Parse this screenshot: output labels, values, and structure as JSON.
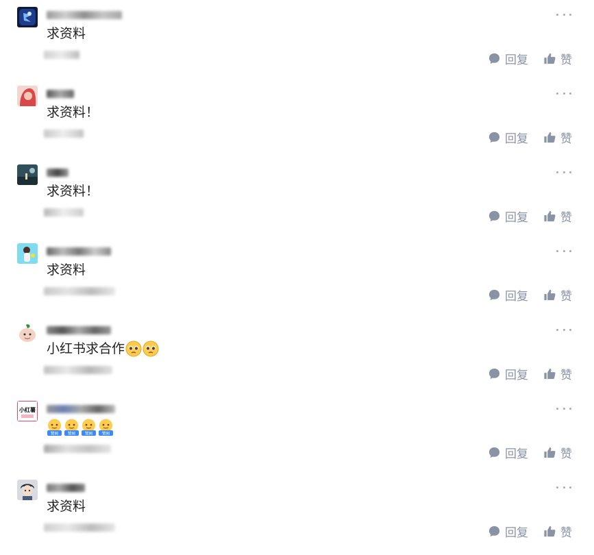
{
  "actions": {
    "reply_label": "回复",
    "like_label": "赞"
  },
  "comments": [
    {
      "text": "求资料",
      "kind": "text"
    },
    {
      "text": "求资料！",
      "kind": "text"
    },
    {
      "text": "求资料！",
      "kind": "text"
    },
    {
      "text": "求资料",
      "kind": "text"
    },
    {
      "text": "小红书求合作",
      "kind": "text",
      "emoji": [
        "pleading-face",
        "pleading-face"
      ]
    },
    {
      "text": "",
      "kind": "stickers",
      "sticker_label": "赞同",
      "stickers": [
        "sticker-agree",
        "sticker-agree",
        "sticker-agree",
        "sticker-agree"
      ],
      "avatar_label": "小红薯"
    },
    {
      "text": "求资料",
      "kind": "text"
    }
  ],
  "colors": {
    "text": "#222222",
    "action": "#8a92a6",
    "more_dots": "#a3a9b6"
  }
}
